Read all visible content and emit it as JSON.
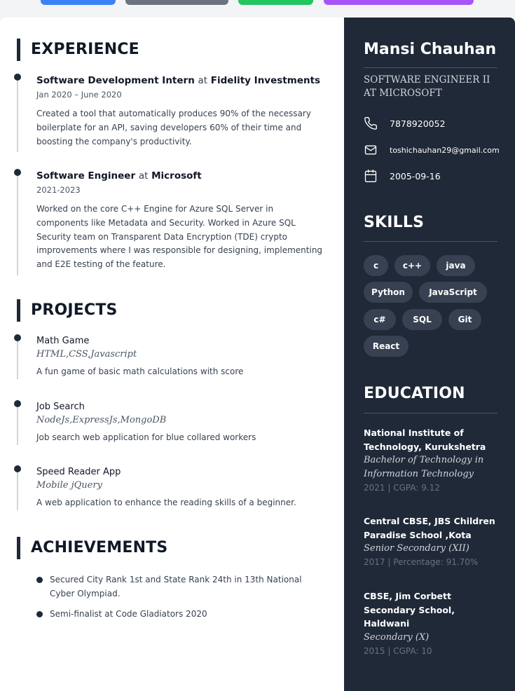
{
  "header_buttons": [
    {
      "name": "blue-button",
      "color": "#3b82f6"
    },
    {
      "name": "gray-button",
      "color": "#6b7280"
    },
    {
      "name": "green-button",
      "color": "#22c55e"
    },
    {
      "name": "purple-button",
      "color": "#a855f7"
    }
  ],
  "profile": {
    "name": "Mansi Chauhan",
    "role": "SOFTWARE ENGINEER II AT MICROSOFT",
    "phone": "7878920052",
    "email": "toshichauhan29@gmail.com",
    "dob": "2005-09-16"
  },
  "sections": {
    "experience": "EXPERIENCE",
    "projects": "PROJECTS",
    "achievements": "ACHIEVEMENTS",
    "skills": "SKILLS",
    "education": "EDUCATION"
  },
  "experience": [
    {
      "role": "Software Development Intern",
      "at": "at",
      "company": "Fidelity Investments",
      "date": "Jan 2020 – June 2020",
      "desc": "Created a tool that automatically produces 90% of the necessary boilerplate for an API, saving developers 60% of their time and boosting the company's productivity."
    },
    {
      "role": "Software Engineer",
      "at": "at",
      "company": "Microsoft",
      "date": "2021-2023",
      "desc": "Worked on the core C++ Engine for Azure SQL Server in components like Metadata and Security. Worked in Azure SQL Security team on Transparent Data Encryption (TDE) crypto improvements where I was responsible for designing, implementing and E2E testing of the feature."
    }
  ],
  "projects": [
    {
      "title": "Math Game",
      "tech": "HTML,CSS,Javascript",
      "desc": "A fun game of basic math calculations with score"
    },
    {
      "title": "Job Search",
      "tech": "NodeJs,ExpressJs,MongoDB",
      "desc": "Job search web application for blue collared workers"
    },
    {
      "title": "Speed Reader App",
      "tech": "Mobile jQuery",
      "desc": "A web application to enhance the reading skills of a beginner."
    }
  ],
  "achievements": [
    "Secured City Rank 1st and State Rank 24th in 13th National Cyber Olympiad.",
    "Semi-finalist at Code Gladiators 2020"
  ],
  "skills": [
    "c",
    "c++",
    "java",
    "Python",
    "JavaScript",
    "c#",
    "SQL",
    "Git",
    "React"
  ],
  "education": [
    {
      "school": "National Institute of Technology, Kurukshetra",
      "degree": "Bachelor of Technology in Information Technology",
      "meta": "2021 | CGPA: 9.12"
    },
    {
      "school": "Central CBSE, JBS Children Paradise School ,Kota",
      "degree": "Senior Secondary (XII)",
      "meta": "2017 | Percentage: 91.70%"
    },
    {
      "school": "CBSE, Jim Corbett Secondary School, Haldwani",
      "degree": "Secondary (X)",
      "meta": "2015 | CGPA: 10"
    }
  ]
}
